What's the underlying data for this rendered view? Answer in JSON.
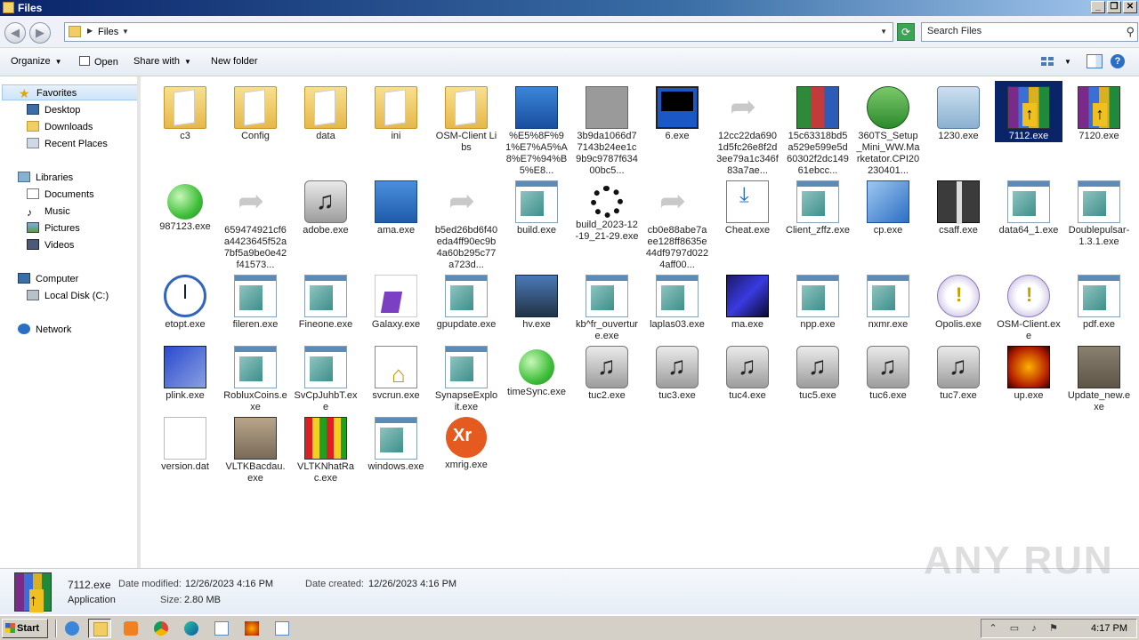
{
  "window": {
    "title": "Files"
  },
  "address": {
    "path": "Files",
    "search_placeholder": "Search Files"
  },
  "toolbar": {
    "organize": "Organize",
    "open": "Open",
    "share_with": "Share with",
    "new_folder": "New folder"
  },
  "sidebar": {
    "favorites": "Favorites",
    "desktop": "Desktop",
    "downloads": "Downloads",
    "recent_places": "Recent Places",
    "libraries": "Libraries",
    "documents": "Documents",
    "music": "Music",
    "pictures": "Pictures",
    "videos": "Videos",
    "computer": "Computer",
    "local_disk": "Local Disk (C:)",
    "network": "Network"
  },
  "files": [
    {
      "name": "c3",
      "icon": "folder-icon"
    },
    {
      "name": "Config",
      "icon": "folder-icon"
    },
    {
      "name": "data",
      "icon": "folder-icon"
    },
    {
      "name": "ini",
      "icon": "folder-icon"
    },
    {
      "name": "OSM-Client Libs",
      "icon": "folder-icon"
    },
    {
      "name": "%E5%8F%91%E7%A5%A8%E7%94%B5%E8...",
      "icon": "shield-folder-icon"
    },
    {
      "name": "3b9da1066d77143b24ee1c9b9c9787f63400bc5...",
      "icon": "grey-file-icon"
    },
    {
      "name": "6.exe",
      "icon": "terminal-icon"
    },
    {
      "name": "12cc22da6901d5fc26e8f2d3ee79a1c346f83a7ae...",
      "icon": "shortcut-arrow-icon"
    },
    {
      "name": "15c63318bd5a529e599e5d60302f2dc14961ebcc...",
      "icon": "package-icon"
    },
    {
      "name": "360TS_Setup_Mini_WW.Marketator.CPI20230401...",
      "icon": "installer-icon"
    },
    {
      "name": "1230.exe",
      "icon": "disc-icon"
    },
    {
      "name": "7112.exe",
      "icon": "winrar-icon"
    },
    {
      "name": "7120.exe",
      "icon": "winrar-icon"
    },
    {
      "name": "987123.exe",
      "icon": "green-orb-icon"
    },
    {
      "name": "659474921cf6a4423645f52a7bf5a9be0e42f41573...",
      "icon": "shortcut-arrow-icon"
    },
    {
      "name": "adobe.exe",
      "icon": "music-file-icon"
    },
    {
      "name": "ama.exe",
      "icon": "computer-icon"
    },
    {
      "name": "b5ed26bd6f40eda4ff90ec9b4a60b295c77a723d...",
      "icon": "shortcut-arrow-icon"
    },
    {
      "name": "build.exe",
      "icon": "app-window-icon"
    },
    {
      "name": "build_2023-12-19_21-29.exe",
      "icon": "spinner-icon"
    },
    {
      "name": "cb0e88abe7aee128ff8635e44df9797d0224aff00...",
      "icon": "shortcut-arrow-icon"
    },
    {
      "name": "Cheat.exe",
      "icon": "download-tray-icon"
    },
    {
      "name": "Client_zffz.exe",
      "icon": "app-window-icon"
    },
    {
      "name": "cp.exe",
      "icon": "cube-icon"
    },
    {
      "name": "csaff.exe",
      "icon": "gift-icon"
    },
    {
      "name": "data64_1.exe",
      "icon": "app-window-icon"
    },
    {
      "name": "Doublepulsar-1.3.1.exe",
      "icon": "app-window-icon"
    },
    {
      "name": "etopt.exe",
      "icon": "clock-icon"
    },
    {
      "name": "fileren.exe",
      "icon": "app-window-icon"
    },
    {
      "name": "Fineone.exe",
      "icon": "app-window-icon"
    },
    {
      "name": "Galaxy.exe",
      "icon": "visual-studio-icon"
    },
    {
      "name": "gpupdate.exe",
      "icon": "app-window-icon"
    },
    {
      "name": "hv.exe",
      "icon": "game-box-icon"
    },
    {
      "name": "kb^fr_ouverture.exe",
      "icon": "app-window-icon"
    },
    {
      "name": "laplas03.exe",
      "icon": "app-window-icon"
    },
    {
      "name": "ma.exe",
      "icon": "dark-box-icon"
    },
    {
      "name": "npp.exe",
      "icon": "app-window-icon"
    },
    {
      "name": "nxmr.exe",
      "icon": "app-window-icon"
    },
    {
      "name": "Opolis.exe",
      "icon": "info-orb-icon"
    },
    {
      "name": "OSM-Client.exe",
      "icon": "info-orb-icon"
    },
    {
      "name": "pdf.exe",
      "icon": "app-window-icon"
    },
    {
      "name": "plink.exe",
      "icon": "network-computers-icon"
    },
    {
      "name": "RobluxCoins.exe",
      "icon": "app-window-icon"
    },
    {
      "name": "SvCpJuhbT.exe",
      "icon": "app-window-icon"
    },
    {
      "name": "svcrun.exe",
      "icon": "document-house-icon"
    },
    {
      "name": "SynapseExploit.exe",
      "icon": "app-window-icon"
    },
    {
      "name": "timeSync.exe",
      "icon": "green-orb-icon"
    },
    {
      "name": "tuc2.exe",
      "icon": "music-file-icon"
    },
    {
      "name": "tuc3.exe",
      "icon": "music-file-icon"
    },
    {
      "name": "tuc4.exe",
      "icon": "music-file-icon"
    },
    {
      "name": "tuc5.exe",
      "icon": "music-file-icon"
    },
    {
      "name": "tuc6.exe",
      "icon": "music-file-icon"
    },
    {
      "name": "tuc7.exe",
      "icon": "music-file-icon"
    },
    {
      "name": "up.exe",
      "icon": "flame-emblem-icon"
    },
    {
      "name": "Update_new.exe",
      "icon": "stone-box-icon"
    },
    {
      "name": "version.dat",
      "icon": "blank-file-icon"
    },
    {
      "name": "VLTKBacdau.exe",
      "icon": "knight-icon"
    },
    {
      "name": "VLTKNhatRac.exe",
      "icon": "pixel-game-icon"
    },
    {
      "name": "windows.exe",
      "icon": "app-window-icon"
    },
    {
      "name": "xmrig.exe",
      "icon": "xmrig-logo-icon"
    }
  ],
  "details": {
    "name": "7112.exe",
    "type": "Application",
    "modified_label": "Date modified:",
    "modified_value": "12/26/2023 4:16 PM",
    "created_label": "Date created:",
    "created_value": "12/26/2023 4:16 PM",
    "size_label": "Size:",
    "size_value": "2.80 MB"
  },
  "watermark": "ANY RUN",
  "taskbar": {
    "start": "Start",
    "clock": "4:17 PM"
  }
}
